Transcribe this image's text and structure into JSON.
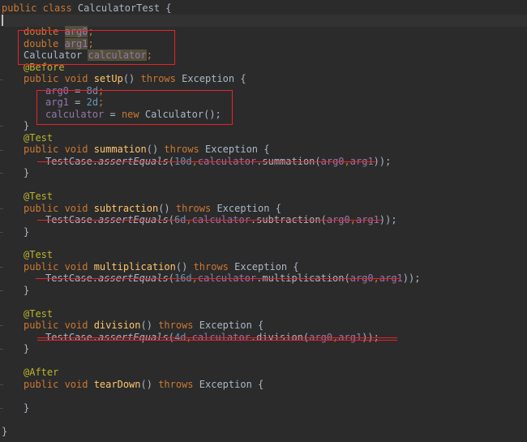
{
  "code": {
    "l_class": {
      "kw": "public class ",
      "name": "CalculatorTest",
      "tail": " {"
    },
    "f_arg0": {
      "type": "double ",
      "name": "arg0",
      "semi": ";"
    },
    "f_arg1": {
      "type": "double ",
      "name": "arg1",
      "semi": ";"
    },
    "f_calc": {
      "type": "Calculator ",
      "name": "calculator",
      "semi": ";"
    },
    "before_ann": "@Before",
    "setup_sig": {
      "mods": "public void ",
      "name": "setUp",
      "params": "() ",
      "throws": "throws ",
      "exc": "Exception {"
    },
    "setup_a0": {
      "name": "arg0",
      "eq": " = ",
      "val": "8d",
      "semi": ";"
    },
    "setup_a1": {
      "name": "arg1",
      "eq": " = ",
      "val": "2d",
      "semi": ";"
    },
    "setup_calc": {
      "name": "calculator",
      "eq": " = ",
      "kw": "new ",
      "rest": "Calculator();"
    },
    "close_brace": "}",
    "test_ann": "@Test",
    "after_ann": "@After",
    "summation": {
      "mods": "public void ",
      "name": "summation",
      "params": "() ",
      "throws": "throws ",
      "exc": "Exception {",
      "cls": "TestCase.",
      "call": "assertEquals",
      "open": "(",
      "num": "10d",
      "comma": ",",
      "fld": "calculator",
      "method": ".summation(",
      "a0": "arg0",
      "c2": ",",
      "a1": "arg1",
      "end": "));"
    },
    "subtraction": {
      "mods": "public void ",
      "name": "subtraction",
      "params": "() ",
      "throws": "throws ",
      "exc": "Exception {",
      "cls": "TestCase.",
      "call": "assertEquals",
      "open": "(",
      "num": "6d",
      "comma": ",",
      "fld": "calculator",
      "method": ".subtraction(",
      "a0": "arg0",
      "c2": ",",
      "a1": "arg1",
      "end": "));"
    },
    "multiplication": {
      "mods": "public void ",
      "name": "multiplication",
      "params": "() ",
      "throws": "throws ",
      "exc": "Exception {",
      "cls": "TestCase.",
      "call": "assertEquals",
      "open": "(",
      "num": "16d",
      "comma": ",",
      "fld": "calculator",
      "method": ".multiplication(",
      "a0": "arg0",
      "c2": ",",
      "a1": "arg1",
      "end": "));"
    },
    "division": {
      "mods": "public void ",
      "name": "division",
      "params": "() ",
      "throws": "throws ",
      "exc": "Exception {",
      "cls": "TestCase.",
      "call": "assertEquals",
      "open": "(",
      "num": "4d",
      "comma": ",",
      "fld": "calculator",
      "method": ".division(",
      "a0": "arg0",
      "c2": ",",
      "a1": "arg1",
      "end": "));"
    },
    "teardown_sig": {
      "mods": "public void ",
      "name": "tearDown",
      "params": "() ",
      "throws": "throws ",
      "exc": "Exception {"
    }
  },
  "colors": {
    "annotation_red": "#e8222a",
    "keyword": "#cc7832",
    "field": "#9876aa",
    "method": "#ffc66d",
    "number": "#6897bb",
    "metadata": "#bbb529"
  }
}
